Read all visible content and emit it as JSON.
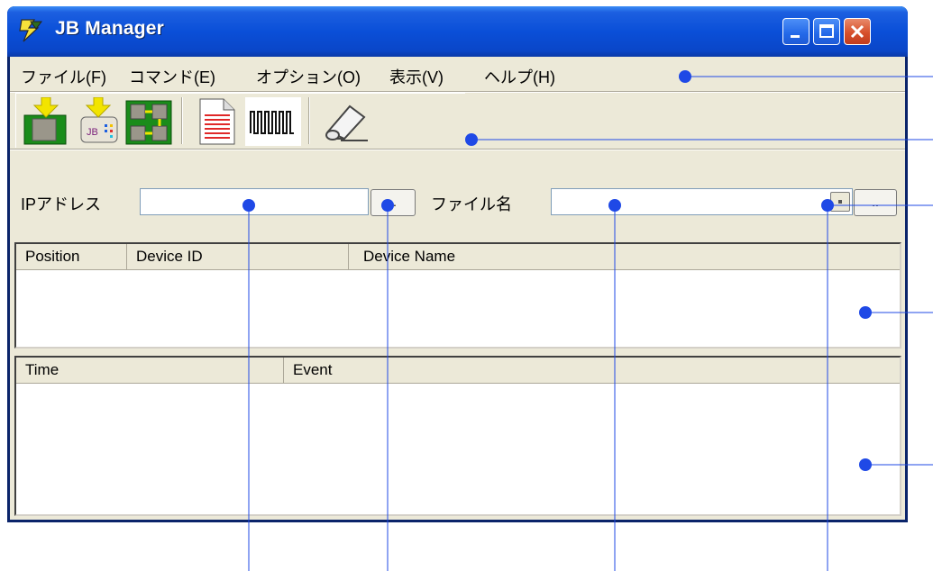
{
  "window": {
    "title": "JB Manager"
  },
  "titlebar_buttons": {
    "minimize": "minimize-icon",
    "maximize": "maximize-icon",
    "close": "close-icon"
  },
  "menubar": {
    "items": [
      {
        "label": "ファイル(F)"
      },
      {
        "label": "コマンド(E)"
      },
      {
        "label": "オプション(O)"
      },
      {
        "label": "表示(V)"
      },
      {
        "label": "ヘルプ(H)"
      }
    ]
  },
  "toolbar": {
    "icons": [
      "chip-load-icon",
      "jb-file-load-icon",
      "jtag-chain-icon",
      "document-icon",
      "waveform-icon",
      "eraser-icon"
    ]
  },
  "inputs": {
    "ip_label": "IPアドレス",
    "ip_value": "",
    "ip_browse": "..",
    "file_label": "ファイル名",
    "file_value": "",
    "file_browse": ".."
  },
  "device_list": {
    "columns": [
      "Position",
      "Device ID",
      "Device Name"
    ],
    "rows": []
  },
  "event_list": {
    "columns": [
      "Time",
      "Event"
    ],
    "rows": []
  },
  "colors": {
    "callout": "#1f49e6",
    "titlebar": "#0a4fd8",
    "face": "#ece9d8"
  }
}
